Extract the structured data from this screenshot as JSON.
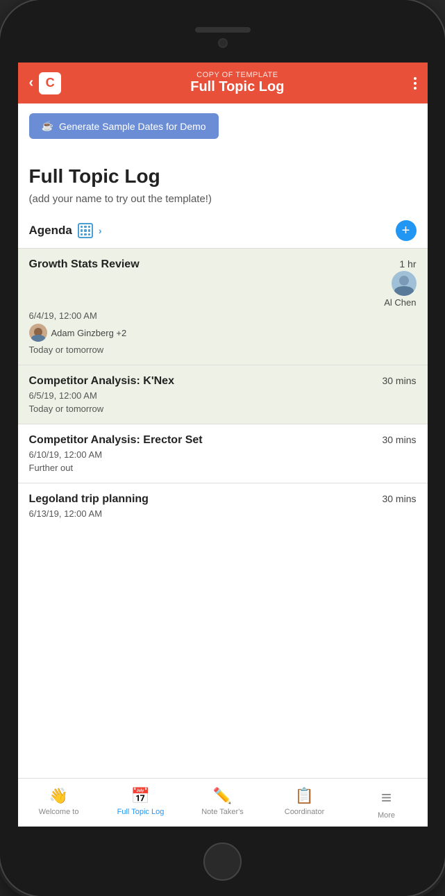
{
  "phone": {
    "header": {
      "back_label": "‹",
      "subtitle": "COPY OF TEMPLATE",
      "title": "Full Topic Log",
      "more_icon": "more-vertical-icon"
    },
    "generate_btn": {
      "icon": "☕",
      "label": "Generate Sample Dates for Demo"
    },
    "page": {
      "main_title": "Full Topic Log",
      "subtitle": "(add your name to try out the template!)",
      "agenda_label": "Agenda",
      "add_icon": "+"
    },
    "topics": [
      {
        "name": "Growth Stats Review",
        "duration": "1 hr",
        "date": "6/4/19, 12:00 AM",
        "assignee": "Adam Ginzberg +2",
        "assignee2": "Al Chen",
        "timing": "Today or tomorrow",
        "highlighted": true
      },
      {
        "name": "Competitor Analysis: K'Nex",
        "duration": "30 mins",
        "date": "6/5/19, 12:00 AM",
        "assignee": null,
        "assignee2": null,
        "timing": "Today or tomorrow",
        "highlighted": true
      },
      {
        "name": "Competitor Analysis: Erector Set",
        "duration": "30 mins",
        "date": "6/10/19, 12:00 AM",
        "assignee": null,
        "assignee2": null,
        "timing": "Further out",
        "highlighted": false
      },
      {
        "name": "Legoland trip planning",
        "duration": "30 mins",
        "date": "6/13/19, 12:00 AM",
        "assignee": null,
        "assignee2": null,
        "timing": null,
        "highlighted": false
      }
    ],
    "bottom_nav": [
      {
        "icon": "👋",
        "label": "Welcome to",
        "active": false
      },
      {
        "icon": "📅",
        "label": "Full Topic Log",
        "active": true
      },
      {
        "icon": "✏️",
        "label": "Note Taker's",
        "active": false
      },
      {
        "icon": "📋",
        "label": "Coordinator",
        "active": false
      },
      {
        "icon": "≡",
        "label": "More",
        "active": false
      }
    ]
  }
}
